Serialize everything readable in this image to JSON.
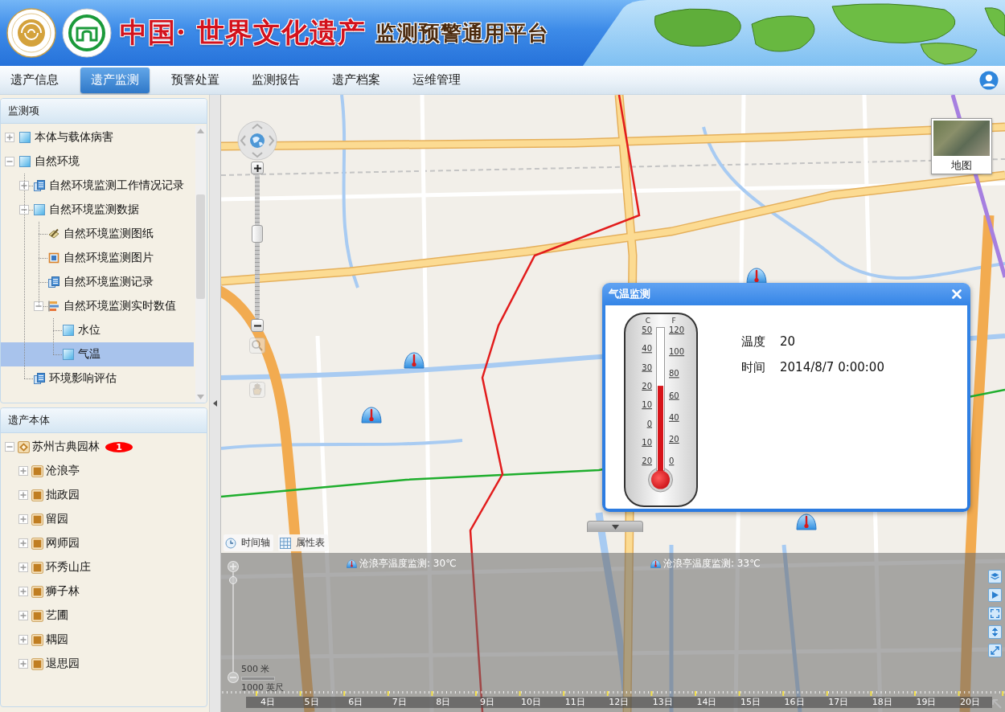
{
  "header": {
    "title": "中国· 世界文化遗产",
    "subtitle": "监测预警通用平台"
  },
  "nav": {
    "tabs": [
      {
        "label": "遗产信息",
        "selected": false
      },
      {
        "label": "遗产监测",
        "selected": true
      },
      {
        "label": "预警处置",
        "selected": false
      },
      {
        "label": "监测报告",
        "selected": false
      },
      {
        "label": "遗产档案",
        "selected": false
      },
      {
        "label": "运维管理",
        "selected": false
      }
    ]
  },
  "sidebar": {
    "panels": [
      {
        "title": "监测项",
        "tree": [
          {
            "label": "本体与载体病害",
            "kind": "layer",
            "expanded": false,
            "selected": false
          },
          {
            "label": "自然环境",
            "kind": "layer",
            "expanded": true,
            "selected": false,
            "children": [
              {
                "label": "自然环境监测工作情况记录",
                "kind": "record",
                "expanded": false,
                "selected": false
              },
              {
                "label": "自然环境监测数据",
                "kind": "layer",
                "expanded": true,
                "selected": false,
                "children": [
                  {
                    "label": "自然环境监测图纸",
                    "kind": "drawing",
                    "selected": false
                  },
                  {
                    "label": "自然环境监测图片",
                    "kind": "image",
                    "selected": false
                  },
                  {
                    "label": "自然环境监测记录",
                    "kind": "record",
                    "selected": false
                  },
                  {
                    "label": "自然环境监测实时数值",
                    "kind": "realtime",
                    "expanded": true,
                    "selected": false,
                    "children": [
                      {
                        "label": "水位",
                        "kind": "layer",
                        "selected": false
                      },
                      {
                        "label": "气温",
                        "kind": "layer",
                        "selected": true
                      }
                    ]
                  }
                ]
              },
              {
                "label": "环境影响评估",
                "kind": "record",
                "selected": false
              }
            ]
          }
        ]
      },
      {
        "title": "遗产本体",
        "tree": [
          {
            "label": "苏州古典园林",
            "kind": "site",
            "badge": "1",
            "expanded": true,
            "selected": false,
            "children": [
              {
                "label": "沧浪亭",
                "kind": "garden",
                "expanded": false,
                "selected": false
              },
              {
                "label": "拙政园",
                "kind": "garden",
                "expanded": false,
                "selected": false
              },
              {
                "label": "留园",
                "kind": "garden",
                "expanded": false,
                "selected": false
              },
              {
                "label": "网师园",
                "kind": "garden",
                "expanded": false,
                "selected": false
              },
              {
                "label": "环秀山庄",
                "kind": "garden",
                "expanded": false,
                "selected": false
              },
              {
                "label": "狮子林",
                "kind": "garden",
                "expanded": false,
                "selected": false
              },
              {
                "label": "艺圃",
                "kind": "garden",
                "expanded": false,
                "selected": false
              },
              {
                "label": "耦园",
                "kind": "garden",
                "expanded": false,
                "selected": false
              },
              {
                "label": "退思园",
                "kind": "garden",
                "expanded": false,
                "selected": false
              }
            ]
          }
        ]
      }
    ]
  },
  "map": {
    "map_type_button": "地图",
    "zoom": {
      "level": 0.6
    },
    "popup": {
      "title": "气温监测",
      "thermometer": {
        "units": [
          "C",
          "F"
        ],
        "celsius": [
          "50",
          "40",
          "30",
          "20",
          "10",
          "0",
          "10",
          "20"
        ],
        "fahrenheit": [
          "120",
          "100",
          "80",
          "60",
          "40",
          "20",
          "0"
        ],
        "level": 0.57
      },
      "fields": [
        {
          "label": "温度",
          "value": "20"
        },
        {
          "label": "时间",
          "value": "2014/8/7 0:00:00"
        }
      ]
    },
    "scale": {
      "metric": "500 米",
      "imperial": "1000 英尺"
    },
    "timeline": {
      "tabs": [
        {
          "label": "时间轴",
          "kind": "timeline"
        },
        {
          "label": "属性表",
          "kind": "table"
        }
      ],
      "events": [
        "沧浪亭温度监测: 30℃",
        "沧浪亭温度监测: 33℃"
      ],
      "zoom": {
        "level": 0.96
      },
      "days": [
        "4日",
        "5日",
        "6日",
        "7日",
        "8日",
        "9日",
        "10日",
        "11日",
        "12日",
        "13日",
        "14日",
        "15日",
        "16日",
        "17日",
        "18日",
        "19日",
        "20日"
      ]
    }
  }
}
